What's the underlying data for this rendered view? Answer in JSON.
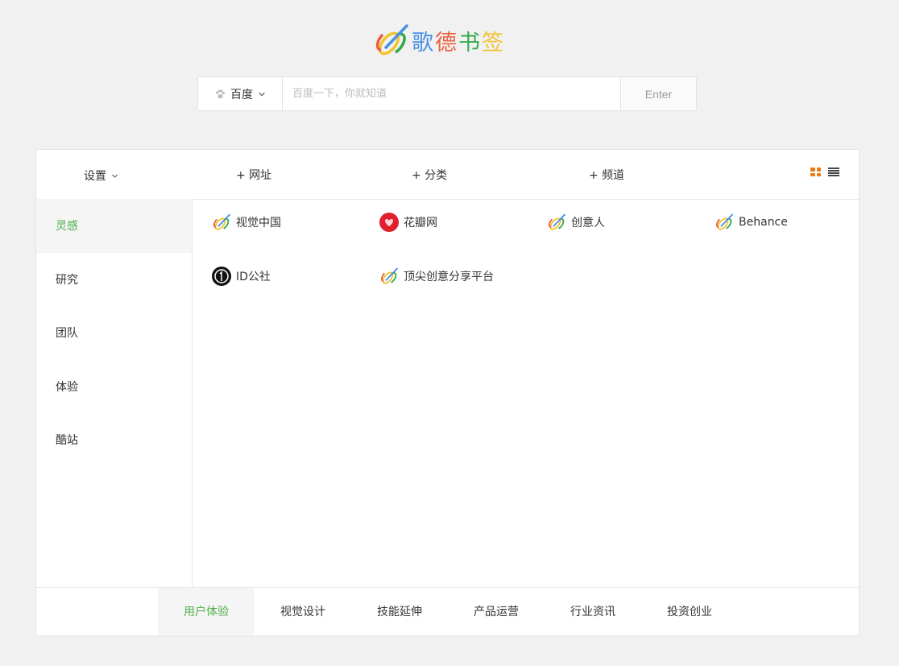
{
  "logo": {
    "chars": [
      "歌",
      "德",
      "书",
      "签"
    ],
    "colors": [
      "#4a90e2",
      "#ea5f3e",
      "#35a94a",
      "#f2c230"
    ]
  },
  "search": {
    "engine_label": "百度",
    "placeholder": "百度一下，你就知道",
    "enter_label": "Enter"
  },
  "toolbar": {
    "settings_label": "设置",
    "add_url": "+ 网址",
    "add_category": "+ 分类",
    "add_channel": "+ 频道"
  },
  "sidebar": {
    "items": [
      {
        "label": "灵感",
        "active": true
      },
      {
        "label": "研究",
        "active": false
      },
      {
        "label": "团队",
        "active": false
      },
      {
        "label": "体验",
        "active": false
      },
      {
        "label": "酷站",
        "active": false
      }
    ]
  },
  "sites": [
    {
      "label": "视觉中国",
      "icon": "gede-logo-icon"
    },
    {
      "label": "花瓣网",
      "icon": "huaban-icon"
    },
    {
      "label": "创意人",
      "icon": "gede-logo-icon"
    },
    {
      "label": "Behance",
      "icon": "gede-logo-icon"
    },
    {
      "label": "ID公社",
      "icon": "idgongshe-icon"
    },
    {
      "label": "顶尖创意分享平台",
      "icon": "gede-logo-icon"
    }
  ],
  "bottom_tabs": [
    {
      "label": "用户体验",
      "active": true
    },
    {
      "label": "视觉设计",
      "active": false
    },
    {
      "label": "技能延伸",
      "active": false
    },
    {
      "label": "产品运营",
      "active": false
    },
    {
      "label": "行业资讯",
      "active": false
    },
    {
      "label": "投资创业",
      "active": false
    }
  ],
  "colors": {
    "accent": "#4fae4a",
    "grid_icon": "#ea7a16"
  }
}
